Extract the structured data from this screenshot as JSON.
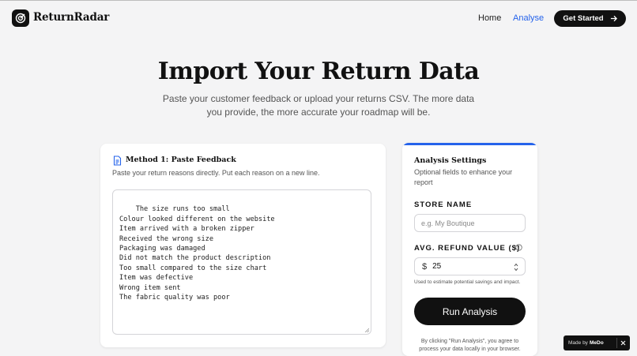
{
  "header": {
    "brand": "ReturnRadar",
    "logo_icon": "radar-target-icon",
    "nav": [
      {
        "label": "Home",
        "active": false
      },
      {
        "label": "Analyse",
        "active": true
      }
    ],
    "cta_label": "Get Started",
    "cta_icon": "arrow-right-icon"
  },
  "hero": {
    "title": "Import Your Return Data",
    "subtitle": "Paste your customer feedback or upload your returns CSV. The more data you provide, the more accurate your roadmap will be."
  },
  "paste_card": {
    "icon": "document-icon",
    "title": "Method 1: Paste Feedback",
    "description": "Paste your return reasons directly. Put each reason on a new line.",
    "textarea_value": "The size runs too small\nColour looked different on the website\nItem arrived with a broken zipper\nReceived the wrong size\nPackaging was damaged\nDid not match the product description\nToo small compared to the size chart\nItem was defective\nWrong item sent\nThe fabric quality was poor"
  },
  "settings": {
    "title": "Analysis Settings",
    "description": "Optional fields to enhance your report",
    "store_label": "STORE NAME",
    "store_placeholder": "e.g. My Boutique",
    "store_value": "",
    "refund_label": "AVG. REFUND VALUE ($)",
    "refund_currency": "$",
    "refund_value": "25",
    "refund_help": "Used to estimate potential savings and impact.",
    "run_label": "Run Analysis",
    "legal": "By clicking \"Run Analysis\", you agree to process your data locally in your browser."
  },
  "badge": {
    "made_by": "Made by",
    "brand": "MeDo"
  },
  "colors": {
    "accent": "#2563eb",
    "dark": "#111111",
    "background": "#f4f4f5"
  }
}
